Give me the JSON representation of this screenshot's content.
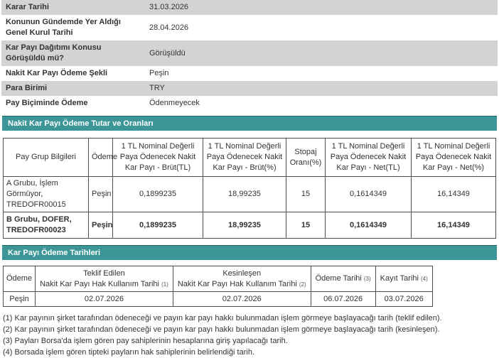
{
  "colors": {
    "accent": "#3C9596",
    "row_gray": "#d3d3d3",
    "table_border": "#4d4d4d",
    "text": "#333333"
  },
  "info_rows": [
    {
      "label": "Karar Tarihi",
      "value": "31.03.2026"
    },
    {
      "label": "Konunun Gündemde Yer Aldığı Genel Kurul Tarihi",
      "value": "28.04.2026"
    },
    {
      "label": "Kar Payı Dağıtımı Konusu Görüşüldü mü?",
      "value": "Görüşüldü"
    },
    {
      "label": "Nakit Kar Payı Ödeme Şekli",
      "value": "Peşin"
    },
    {
      "label": "Para Birimi",
      "value": "TRY"
    },
    {
      "label": "Pay Biçiminde Ödeme",
      "value": "Ödenmeyecek"
    }
  ],
  "amounts_section": {
    "title": "Nakit Kar Payı Ödeme Tutar ve Oranları",
    "headers": [
      "Pay Grup Bilgileri",
      "Ödeme",
      "1 TL Nominal Değerli Paya Ödenecek Nakit Kar Payı - Brüt(TL)",
      "1 TL Nominal Değerli Paya Ödenecek Nakit Kar Payı - Brüt(%)",
      "Stopaj Oranı(%)",
      "1 TL Nominal Değerli Paya Ödenecek Nakit Kar Payı - Net(TL)",
      "1 TL Nominal Değerli Paya Ödenecek Nakit Kar Payı - Net(%)"
    ],
    "rows": [
      [
        "A Grubu, İşlem Görmüyor, TREDOFR00015",
        "Peşin",
        "0,1899235",
        "18,99235",
        "15",
        "0,1614349",
        "16,14349"
      ],
      [
        "B Grubu, DOFER, TREDOFR00023",
        "Peşin",
        "0,1899235",
        "18,99235",
        "15",
        "0,1614349",
        "16,14349"
      ]
    ]
  },
  "dates_section": {
    "title": "Kar Payı Ödeme Tarihleri",
    "headers": {
      "col0": "Ödeme",
      "col1_line1": "Teklif Edilen",
      "col1_line2": "Nakit Kar Payı Hak Kullanım Tarihi",
      "col1_sup": "(1)",
      "col2_line1": "Kesinleşen",
      "col2_line2": "Nakit Kar Payı Hak Kullanım Tarihi",
      "col2_sup": "(2)",
      "col3": "Ödeme Tarihi",
      "col3_sup": "(3)",
      "col4": "Kayıt Tarihi",
      "col4_sup": "(4)"
    },
    "row": [
      "Peşin",
      "02.07.2026",
      "02.07.2026",
      "06.07.2026",
      "03.07.2026"
    ]
  },
  "footnotes": [
    "(1) Kar payının şirket tarafından ödeneceği ve payın kar payı hakkı bulunmadan işlem görmeye başlayacağı tarih (teklif edilen).",
    "(2) Kar payının şirket tarafından ödeneceği ve payın kar payı hakkı bulunmadan işlem görmeye başlayacağı tarih (kesinleşen).",
    "(3) Payları Borsa'da işlem gören pay sahiplerinin hesaplarına giriş yapılacağı tarih.",
    "(4) Borsada işlem gören tipteki payların hak sahiplerinin belirlendiği tarih."
  ]
}
